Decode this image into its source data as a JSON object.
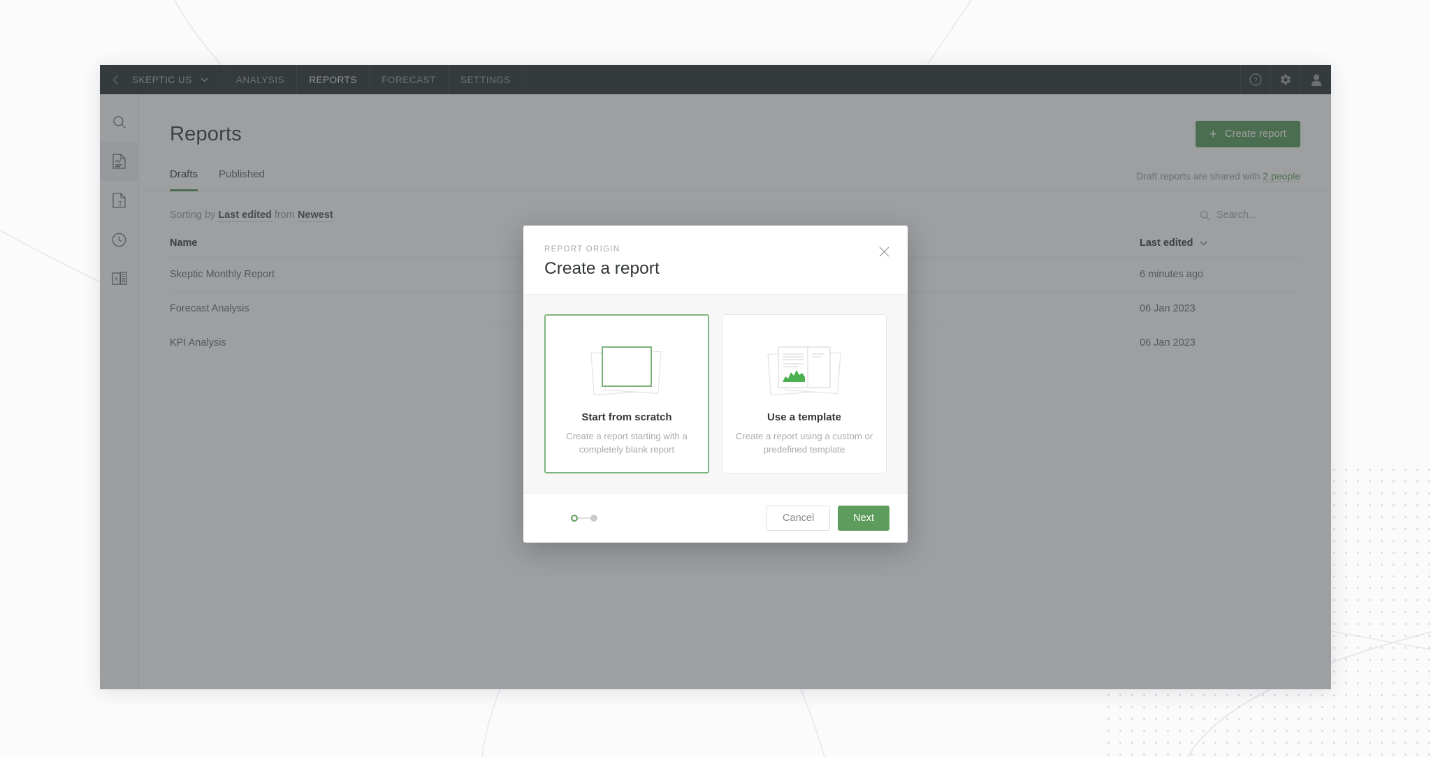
{
  "navbar": {
    "back_icon": "chevron-left-icon",
    "account": "SKEPTIC US",
    "account_caret": "chevron-down-icon",
    "items": [
      {
        "label": "ANALYSIS",
        "active": false
      },
      {
        "label": "REPORTS",
        "active": true
      },
      {
        "label": "FORECAST",
        "active": false
      },
      {
        "label": "SETTINGS",
        "active": false
      }
    ],
    "actions": [
      {
        "icon": "help-icon"
      },
      {
        "icon": "gear-icon"
      },
      {
        "icon": "user-icon"
      }
    ]
  },
  "sidebar": {
    "items": [
      {
        "icon": "search-icon",
        "name": "search",
        "active": false
      },
      {
        "icon": "report-document-icon",
        "name": "reports",
        "active": true
      },
      {
        "icon": "text-document-icon",
        "name": "text-documents",
        "active": false
      },
      {
        "icon": "clock-icon",
        "name": "history",
        "active": false
      },
      {
        "icon": "excel-export-icon",
        "name": "excel-export",
        "active": false
      }
    ]
  },
  "page": {
    "title": "Reports",
    "create_button": {
      "label": "Create report",
      "icon": "plus-icon"
    },
    "tabs": [
      {
        "label": "Drafts",
        "active": true
      },
      {
        "label": "Published",
        "active": false
      }
    ],
    "share_note_prefix": "Draft reports are shared with ",
    "share_note_link": "2 people",
    "sorting": {
      "prefix": "Sorting by",
      "field": "Last edited",
      "middle": "from",
      "order": "Newest"
    },
    "search": {
      "placeholder": "Search...",
      "value": "",
      "icon": "search-icon"
    },
    "table": {
      "columns": [
        {
          "label": "Name"
        },
        {
          "label": "Last edited",
          "icon": "chevron-down-icon"
        }
      ],
      "rows": [
        {
          "name": "Skeptic Monthly Report",
          "last_edited": "6 minutes ago"
        },
        {
          "name": "Forecast Analysis",
          "last_edited": "06 Jan 2023"
        },
        {
          "name": "KPI Analysis",
          "last_edited": "06 Jan 2023"
        }
      ]
    }
  },
  "modal": {
    "eyebrow": "REPORT ORIGIN",
    "title": "Create a report",
    "close_icon": "close-icon",
    "options": [
      {
        "title": "Start from scratch",
        "desc": "Create a report starting with a completely blank report",
        "icon": "blank-pages-icon",
        "selected": true
      },
      {
        "title": "Use a template",
        "desc": "Create a report using a custom or predefined template",
        "icon": "template-pages-icon",
        "selected": false
      }
    ],
    "steps": {
      "current": 1,
      "total": 2
    },
    "cancel_label": "Cancel",
    "next_label": "Next"
  },
  "colors": {
    "accent_green": "#5d9c5d",
    "navbar_dark": "#2f3437",
    "overlay": "rgba(60,64,67,.50)"
  }
}
